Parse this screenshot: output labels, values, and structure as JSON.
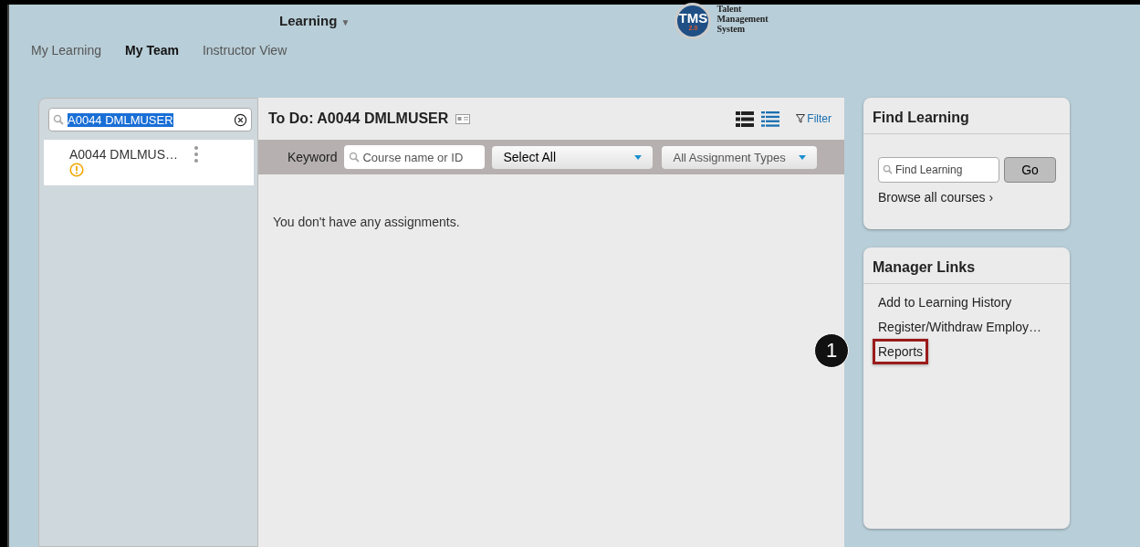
{
  "header": {
    "menu": "Learning",
    "menu_caret": "▼",
    "logo": {
      "badge": "TMS",
      "version": "2.0",
      "lines": [
        "Talent",
        "Management",
        "System"
      ]
    }
  },
  "nav": [
    {
      "label": "My Learning",
      "selected": false
    },
    {
      "label": "My Team",
      "selected": true
    },
    {
      "label": "Instructor View",
      "selected": false
    }
  ],
  "people_panel": {
    "search": {
      "value": "A0044  DMLMUSER",
      "selected_text": true
    },
    "people": [
      {
        "name": "A0044 DMLMUS…",
        "warning": true,
        "selected": true
      }
    ]
  },
  "todo": {
    "title": "To Do: A0044 DMLMUSER",
    "filter": "Filter",
    "keyword_label": "Keyword",
    "keyword": {
      "placeholder": "Course name or ID"
    },
    "status_select": "Select All",
    "type_select": "All Assignment Types",
    "empty_message": "You don't have any assignments."
  },
  "find_learning": {
    "title": "Find Learning",
    "search": {
      "placeholder": "Find Learning"
    },
    "go": "Go",
    "browse": "Browse all courses",
    "browse_chevron": "›"
  },
  "manager_links": {
    "title": "Manager Links",
    "links": [
      {
        "label": "Add to Learning History",
        "highlighted": false
      },
      {
        "label": "Register/Withdraw Employ…",
        "highlighted": false
      },
      {
        "label": "Reports",
        "highlighted": true
      }
    ]
  },
  "callout": {
    "number": "1"
  }
}
